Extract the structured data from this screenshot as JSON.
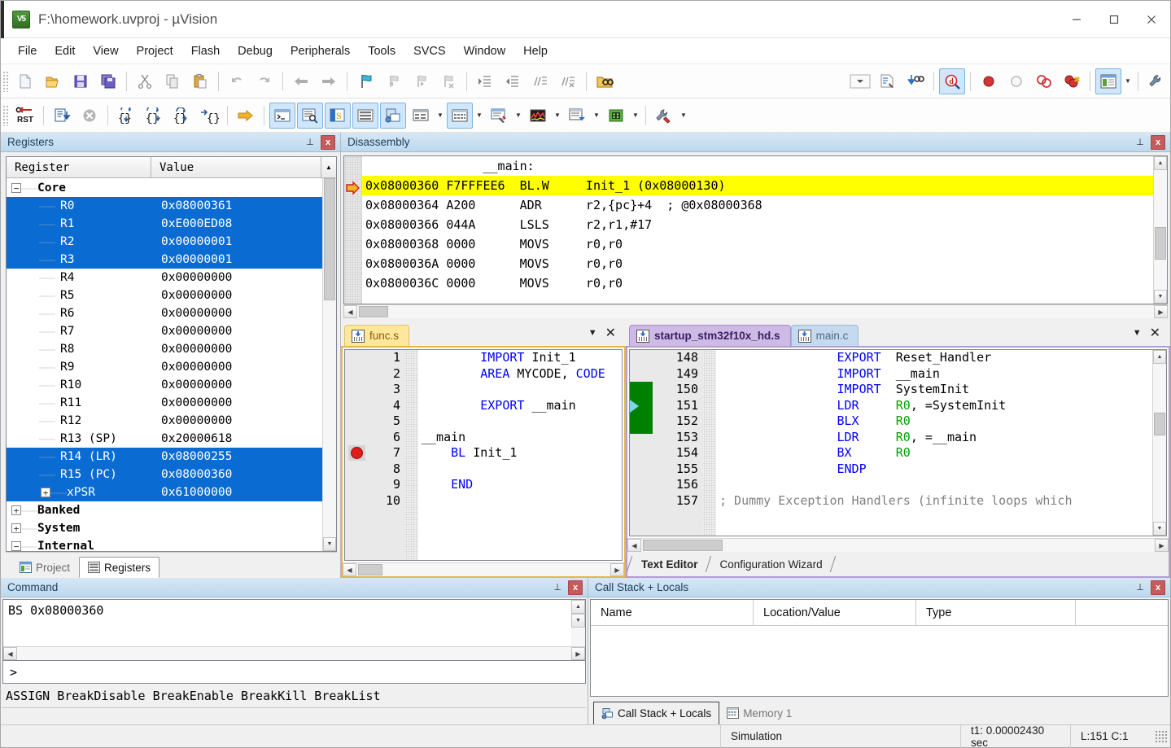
{
  "window": {
    "title": "F:\\homework.uvproj - µVision",
    "logo_text": "V5",
    "minimize": "—",
    "maximize": "☐",
    "close": "✕"
  },
  "menubar": {
    "items": [
      "File",
      "Edit",
      "View",
      "Project",
      "Flash",
      "Debug",
      "Peripherals",
      "Tools",
      "SVCS",
      "Window",
      "Help"
    ]
  },
  "toolbar1": {
    "icons": [
      "new-file-icon",
      "open-folder-icon",
      "save-icon",
      "save-all-icon",
      "cut-icon",
      "copy-icon",
      "paste-icon",
      "undo-icon",
      "redo-icon",
      "back-icon",
      "forward-icon",
      "bookmark-icon",
      "bookmark-prev-icon",
      "bookmark-next-icon",
      "bookmark-clear-icon",
      "indent-icon",
      "outdent-icon",
      "comment-icon",
      "uncomment-icon",
      "find-in-files-icon",
      "target-dropdown-icon",
      "target-options-icon",
      "batch-build-icon",
      "debug-icon",
      "insert-breakpoint-icon",
      "disable-breakpoint-icon",
      "disable-all-breakpoints-icon",
      "kill-all-breakpoints-icon",
      "project-window-icon",
      "configure-icon"
    ]
  },
  "toolbar2": {
    "icons": [
      "reset-icon",
      "run-icon",
      "stop-icon",
      "step-icon",
      "step-over-icon",
      "step-out-icon",
      "run-to-cursor-icon",
      "show-next-statement-icon",
      "command-window-icon",
      "disassembly-window-icon",
      "symbols-window-icon",
      "registers-window-icon",
      "call-stack-icon",
      "watch-window-icon",
      "memory-window-icon",
      "serial-window-icon",
      "analysis-window-icon",
      "trace-icon",
      "system-viewer-icon",
      "toolbox-icon"
    ]
  },
  "registers_panel": {
    "title": "Registers",
    "pin": "⊥",
    "close": "x",
    "columns": [
      "Register",
      "Value"
    ],
    "tree": [
      {
        "kind": "group",
        "expander": "−",
        "label": "Core",
        "indent": 0,
        "selected": false
      },
      {
        "kind": "leaf",
        "label": "R0",
        "value": "0x08000361",
        "selected": true
      },
      {
        "kind": "leaf",
        "label": "R1",
        "value": "0xE000ED08",
        "selected": true
      },
      {
        "kind": "leaf",
        "label": "R2",
        "value": "0x00000001",
        "selected": true
      },
      {
        "kind": "leaf",
        "label": "R3",
        "value": "0x00000001",
        "selected": true
      },
      {
        "kind": "leaf",
        "label": "R4",
        "value": "0x00000000",
        "selected": false
      },
      {
        "kind": "leaf",
        "label": "R5",
        "value": "0x00000000",
        "selected": false
      },
      {
        "kind": "leaf",
        "label": "R6",
        "value": "0x00000000",
        "selected": false
      },
      {
        "kind": "leaf",
        "label": "R7",
        "value": "0x00000000",
        "selected": false
      },
      {
        "kind": "leaf",
        "label": "R8",
        "value": "0x00000000",
        "selected": false
      },
      {
        "kind": "leaf",
        "label": "R9",
        "value": "0x00000000",
        "selected": false
      },
      {
        "kind": "leaf",
        "label": "R10",
        "value": "0x00000000",
        "selected": false
      },
      {
        "kind": "leaf",
        "label": "R11",
        "value": "0x00000000",
        "selected": false
      },
      {
        "kind": "leaf",
        "label": "R12",
        "value": "0x00000000",
        "selected": false
      },
      {
        "kind": "leaf",
        "label": "R13 (SP)",
        "value": "0x20000618",
        "selected": false
      },
      {
        "kind": "leaf",
        "label": "R14 (LR)",
        "value": "0x08000255",
        "selected": true
      },
      {
        "kind": "leaf",
        "label": "R15 (PC)",
        "value": "0x08000360",
        "selected": true
      },
      {
        "kind": "subgroup",
        "expander": "+",
        "label": "xPSR",
        "value": "0x61000000",
        "selected": true
      },
      {
        "kind": "group",
        "expander": "+",
        "label": "Banked",
        "selected": false
      },
      {
        "kind": "group",
        "expander": "+",
        "label": "System",
        "selected": false
      },
      {
        "kind": "group",
        "expander": "−",
        "label": "Internal",
        "selected": false
      }
    ],
    "tabs": [
      {
        "label": "Project",
        "icon": "project-icon",
        "active": false
      },
      {
        "label": "Registers",
        "icon": "registers-icon",
        "active": true
      }
    ]
  },
  "disassembly_panel": {
    "title": "Disassembly",
    "pin": "⊥",
    "close": "x",
    "lines": [
      {
        "text": "                __main:",
        "current": false
      },
      {
        "text": "0x08000360 F7FFFEE6  BL.W     Init_1 (0x08000130)",
        "current": true
      },
      {
        "text": "0x08000364 A200      ADR      r2,{pc}+4  ; @0x08000368",
        "current": false
      },
      {
        "text": "0x08000366 044A      LSLS     r2,r1,#17",
        "current": false
      },
      {
        "text": "0x08000368 0000      MOVS     r0,r0",
        "current": false
      },
      {
        "text": "0x0800036A 0000      MOVS     r0,r0",
        "current": false
      },
      {
        "text": "0x0800036C 0000      MOVS     r0,r0",
        "current": false
      }
    ]
  },
  "editor_left": {
    "tabs": [
      {
        "label": "func.s",
        "icon": "asm-file-icon",
        "active": true
      }
    ],
    "dropdown": "▼",
    "close": "✕",
    "breakpoint_line": 7,
    "lines": [
      {
        "n": "1",
        "parts": [
          {
            "t": "        ",
            "c": ""
          },
          {
            "t": "IMPORT",
            "c": "kw"
          },
          {
            "t": " Init_1",
            "c": ""
          }
        ]
      },
      {
        "n": "2",
        "parts": [
          {
            "t": "        ",
            "c": ""
          },
          {
            "t": "AREA",
            "c": "kw"
          },
          {
            "t": " MYCODE, ",
            "c": ""
          },
          {
            "t": "CODE",
            "c": "kw"
          }
        ]
      },
      {
        "n": "3",
        "parts": []
      },
      {
        "n": "4",
        "parts": [
          {
            "t": "        ",
            "c": ""
          },
          {
            "t": "EXPORT",
            "c": "kw"
          },
          {
            "t": " __main",
            "c": ""
          }
        ]
      },
      {
        "n": "5",
        "parts": []
      },
      {
        "n": "6",
        "parts": [
          {
            "t": "__main",
            "c": ""
          }
        ]
      },
      {
        "n": "7",
        "parts": [
          {
            "t": "    ",
            "c": ""
          },
          {
            "t": "BL",
            "c": "kw"
          },
          {
            "t": " Init_1",
            "c": ""
          }
        ]
      },
      {
        "n": "8",
        "parts": []
      },
      {
        "n": "9",
        "parts": [
          {
            "t": "    ",
            "c": ""
          },
          {
            "t": "END",
            "c": "kw"
          }
        ]
      },
      {
        "n": "10",
        "parts": []
      }
    ]
  },
  "editor_right": {
    "tabs": [
      {
        "label": "startup_stm32f10x_hd.s",
        "icon": "asm-file-icon",
        "active": true
      },
      {
        "label": "main.c",
        "icon": "c-file-icon",
        "active": false
      }
    ],
    "dropdown": "▼",
    "close": "✕",
    "current_line": "151",
    "lines": [
      {
        "n": "148",
        "parts": [
          {
            "t": "                ",
            "c": ""
          },
          {
            "t": "EXPORT",
            "c": "kw"
          },
          {
            "t": "  Reset_Handler",
            "c": ""
          }
        ]
      },
      {
        "n": "149",
        "parts": [
          {
            "t": "                ",
            "c": ""
          },
          {
            "t": "IMPORT",
            "c": "kw"
          },
          {
            "t": "  __main",
            "c": ""
          }
        ]
      },
      {
        "n": "150",
        "parts": [
          {
            "t": "                ",
            "c": ""
          },
          {
            "t": "IMPORT",
            "c": "kw"
          },
          {
            "t": "  SystemInit",
            "c": ""
          }
        ]
      },
      {
        "n": "151",
        "parts": [
          {
            "t": "                ",
            "c": ""
          },
          {
            "t": "LDR",
            "c": "kw"
          },
          {
            "t": "     ",
            "c": ""
          },
          {
            "t": "R0",
            "c": "reg-g"
          },
          {
            "t": ", =SystemInit",
            "c": ""
          }
        ]
      },
      {
        "n": "152",
        "parts": [
          {
            "t": "                ",
            "c": ""
          },
          {
            "t": "BLX",
            "c": "kw"
          },
          {
            "t": "     ",
            "c": ""
          },
          {
            "t": "R0",
            "c": "reg-g"
          }
        ]
      },
      {
        "n": "153",
        "parts": [
          {
            "t": "                ",
            "c": ""
          },
          {
            "t": "LDR",
            "c": "kw"
          },
          {
            "t": "     ",
            "c": ""
          },
          {
            "t": "R0",
            "c": "reg-g"
          },
          {
            "t": ", =__main",
            "c": ""
          }
        ]
      },
      {
        "n": "154",
        "parts": [
          {
            "t": "                ",
            "c": ""
          },
          {
            "t": "BX",
            "c": "kw"
          },
          {
            "t": "      ",
            "c": ""
          },
          {
            "t": "R0",
            "c": "reg-g"
          }
        ]
      },
      {
        "n": "155",
        "parts": [
          {
            "t": "                ",
            "c": ""
          },
          {
            "t": "ENDP",
            "c": "kw"
          }
        ]
      },
      {
        "n": "156",
        "parts": []
      },
      {
        "n": "157",
        "parts": [
          {
            "t": "; Dummy Exception Handlers (infinite loops which",
            "c": "cmt"
          }
        ]
      }
    ],
    "bottom_tabs": [
      {
        "label": "Text Editor",
        "active": true
      },
      {
        "label": "Configuration Wizard",
        "active": false
      }
    ]
  },
  "command_panel": {
    "title": "Command",
    "pin": "⊥",
    "close": "x",
    "output": "BS 0x08000360",
    "prompt": ">",
    "input_value": "",
    "hints": "ASSIGN BreakDisable BreakEnable BreakKill BreakList"
  },
  "callstack_panel": {
    "title": "Call Stack + Locals",
    "pin": "⊥",
    "close": "x",
    "columns": [
      "Name",
      "Location/Value",
      "Type",
      ""
    ],
    "rows": [],
    "tabs": [
      {
        "label": "Call Stack + Locals",
        "icon": "call-stack-icon",
        "active": true
      },
      {
        "label": "Memory 1",
        "icon": "memory-icon",
        "active": false
      }
    ]
  },
  "statusbar": {
    "target": "Simulation",
    "time": "t1: 0.00002430 sec",
    "cursor": "L:151 C:1"
  }
}
